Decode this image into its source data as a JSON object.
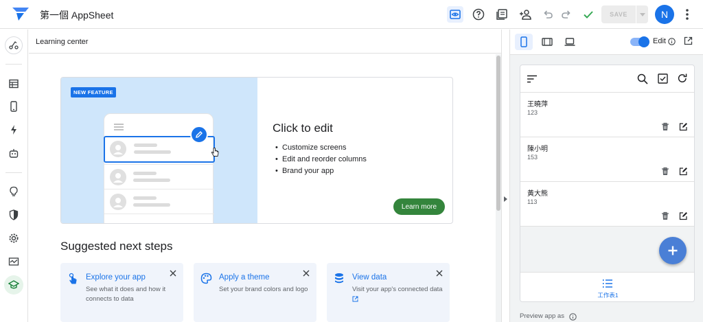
{
  "app": {
    "title": "第一個 AppSheet"
  },
  "toolbar": {
    "save_label": "SAVE",
    "avatar_initial": "N",
    "icons": [
      "preview-eye-icon",
      "help-icon",
      "gallery-icon",
      "share-user-icon",
      "undo-icon",
      "redo-icon",
      "check-icon"
    ]
  },
  "leftrail": {
    "items": [
      "wand-icon",
      "data-icon",
      "views-icon",
      "automation-icon",
      "bot-icon",
      "intelligence-icon",
      "security-icon",
      "settings-icon",
      "monitor-icon",
      "learning-icon"
    ]
  },
  "learning_center": {
    "title": "Learning center",
    "feature": {
      "badge": "NEW FEATURE",
      "title": "Click to edit",
      "bullets": [
        "Customize screens",
        "Edit and reorder columns",
        "Brand your app"
      ],
      "button": "Learn more"
    },
    "next_steps": {
      "title": "Suggested next steps",
      "cards": [
        {
          "title": "Explore your app",
          "desc": "See what it does and how it connects to data",
          "icon": "touch-icon"
        },
        {
          "title": "Apply a theme",
          "desc": "Set your brand colors and logo",
          "icon": "palette-icon"
        },
        {
          "title": "View data",
          "desc": "Visit your app's connected data",
          "icon": "database-icon"
        }
      ]
    }
  },
  "preview": {
    "edit_label": "Edit",
    "edit_enabled": true,
    "items": [
      {
        "name": "王曉萍",
        "value": "123"
      },
      {
        "name": "陳小明",
        "value": "153"
      },
      {
        "name": "黃大熊",
        "value": "113"
      }
    ],
    "nav_label": "工作表1",
    "preview_as": "Preview app as"
  },
  "colors": {
    "accent": "#1a73e8",
    "green": "#34853c",
    "feature_bg": "#cfe6fb",
    "card_bg": "#f0f4fb"
  }
}
